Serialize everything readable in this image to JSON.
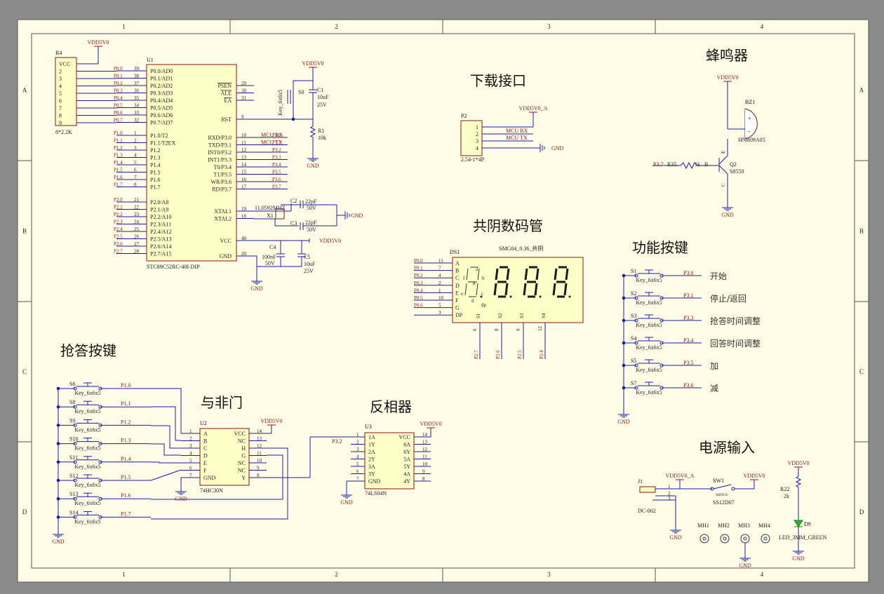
{
  "frame": {
    "columns": [
      "1",
      "2",
      "3",
      "4"
    ],
    "rows": [
      "A",
      "B",
      "C",
      "D"
    ]
  },
  "sections": {
    "download": "下载接口",
    "display": "共阴数码管",
    "buzzer": "蜂鸣器",
    "function_keys": "功能按键",
    "answer_keys": "抢答按键",
    "nand": "与非门",
    "inverter": "反相器",
    "power": "电源输入"
  },
  "r4": {
    "ref": "R4",
    "value": "8*2.2K",
    "pins": [
      "VCC",
      "2",
      "3",
      "4",
      "5",
      "6",
      "7",
      "8",
      "9"
    ],
    "net": "VDD5V0"
  },
  "u1": {
    "ref": "U1",
    "part": "STC89C52RC-40I-DIP",
    "port0": [
      [
        "P0.0/AD0",
        "39",
        "P0.0"
      ],
      [
        "P0.1/AD1",
        "38",
        "P0.1"
      ],
      [
        "P0.2/AD2",
        "37",
        "P0.2"
      ],
      [
        "P0.3/AD3",
        "36",
        "P0.3"
      ],
      [
        "P0.4/AD4",
        "35",
        "P0.4"
      ],
      [
        "P0.5/AD5",
        "34",
        "P0.5"
      ],
      [
        "P0.6/AD6",
        "33",
        "P0.6"
      ],
      [
        "P0.7/AD7",
        "32",
        "P0.7"
      ]
    ],
    "port1": [
      [
        "P1.0/T2",
        "1",
        "P1.0"
      ],
      [
        "P1.1/T2EX",
        "2",
        "P1.1"
      ],
      [
        "P1.2",
        "3",
        "P1.2"
      ],
      [
        "P1.3",
        "4",
        "P1.3"
      ],
      [
        "P1.4",
        "5",
        "P1.4"
      ],
      [
        "P1.5",
        "6",
        "P1.5"
      ],
      [
        "P1.6",
        "7",
        "P1.6"
      ],
      [
        "P1.7",
        "8",
        "P1.7"
      ]
    ],
    "port2": [
      [
        "P2.0/A8",
        "21",
        "P2.0"
      ],
      [
        "P2.1/A9",
        "22",
        "P2.1"
      ],
      [
        "P2.2/A10",
        "23",
        "P2.2"
      ],
      [
        "P2.3/A11",
        "24",
        "P2.3"
      ],
      [
        "P2.4/A12",
        "25",
        "P2.4"
      ],
      [
        "P2.5/A13",
        "26",
        "P2.5"
      ],
      [
        "P2.6/A14",
        "27",
        "P2.6"
      ],
      [
        "P2.7/A15",
        "28",
        "P2.7"
      ]
    ],
    "top_right": [
      [
        "PSEN",
        "29"
      ],
      [
        "ALE",
        "30"
      ],
      [
        "EA",
        "31"
      ],
      [
        "RST",
        "9"
      ]
    ],
    "port3": [
      [
        "RXD/P3.0",
        "10",
        "MCU RX",
        "P3.0"
      ],
      [
        "TXD/P3.1",
        "11",
        "MCU TX",
        "P3.1"
      ],
      [
        "INT0/P3.2",
        "12",
        "",
        "P3.2"
      ],
      [
        "INT1/P3.3",
        "13",
        "",
        "P3.3"
      ],
      [
        "T0/P3.4",
        "14",
        "",
        "P3.4"
      ],
      [
        "T1/P3.5",
        "15",
        "",
        "P3.5"
      ],
      [
        "WR/P3.6",
        "16",
        "",
        "P3.6"
      ],
      [
        "RD/P3.7",
        "17",
        "",
        "P3.7"
      ]
    ],
    "xtal": [
      [
        "XTAL1",
        "19"
      ],
      [
        "XTAL2",
        "18"
      ]
    ],
    "power": [
      [
        "VCC",
        "40"
      ],
      [
        "GND",
        "20"
      ]
    ]
  },
  "reset": {
    "key": "Key_6x6x5",
    "s": "S0",
    "c1": "C1",
    "c1v": "10uF",
    "c1v2": "25V",
    "r1": "R1",
    "r1v": "10k",
    "net": "VDD5V0"
  },
  "crystal": {
    "x1": "X1",
    "freq": "11.0592MHZ",
    "c2": "C2",
    "c3": "C3",
    "cv": "22pF",
    "cv2": "50V"
  },
  "decoupling": {
    "c4": "C4",
    "c4v": "100nF",
    "c4v2": "50V",
    "c5": "C5",
    "c5v": "10uF",
    "c5v2": "25V",
    "net": "VDD5V0"
  },
  "gnd": "GND",
  "vdd": "VDD5V0",
  "p2": {
    "ref": "P2",
    "part": "2.54-1*4P",
    "pins": [
      "1",
      "2",
      "3",
      "4"
    ],
    "nets": [
      "VDD5V0_A",
      "MCU RX",
      "MCU TX",
      "GND"
    ]
  },
  "ds1": {
    "ref": "DS1",
    "part": "SMG04_0.36_共阴",
    "nets": [
      "P0.0",
      "P0.1",
      "P0.2",
      "P0.3",
      "P0.4",
      "P0.5",
      "P0.6",
      ""
    ],
    "pins": [
      "11",
      "7",
      "4",
      "2",
      "1",
      "10",
      "5",
      "3"
    ],
    "letters": [
      "A",
      "B",
      "C",
      "D",
      "E",
      "F",
      "G",
      "DP"
    ],
    "seg_labels": [
      "a",
      "b",
      "c",
      "d",
      "e",
      "f",
      "g",
      "dp"
    ],
    "digits": [
      "S1",
      "S2",
      "S3",
      "S4"
    ],
    "dpins": [
      "6",
      "8",
      "9",
      "12"
    ],
    "dnets": [
      "P2.7",
      "P2.6",
      "P2.5",
      "P2.4"
    ]
  },
  "bz": {
    "ref": "BZ1",
    "part": "HNB09A05",
    "q": "Q2",
    "qpart": "S8550",
    "r": "R35",
    "rv": "1k",
    "net": "P3.7",
    "plus": "+",
    "minus": "-",
    "b": "B",
    "e": "E",
    "c": "C"
  },
  "func_keys": [
    {
      "s": "S1",
      "key": "Key_6x6x5",
      "net": "P3.0",
      "label": "开始"
    },
    {
      "s": "S2",
      "key": "Key_6x6x5",
      "net": "P3.1",
      "label": "停止/返回"
    },
    {
      "s": "S3",
      "key": "Key_6x6x5",
      "net": "P3.3",
      "label": "抢答时间调整"
    },
    {
      "s": "S4",
      "key": "Key_6x6x5",
      "net": "P3.4",
      "label": "回答时间调整"
    },
    {
      "s": "S5",
      "key": "Key_6x6x5",
      "net": "P3.5",
      "label": "加"
    },
    {
      "s": "S7",
      "key": "Key_6x6x5",
      "net": "P3.6",
      "label": "减"
    }
  ],
  "ans_keys": [
    {
      "s": "S6",
      "key": "Key_6x6x5",
      "net": "P1.0"
    },
    {
      "s": "S8",
      "key": "Key_6x6x5",
      "net": "P1.1"
    },
    {
      "s": "S9",
      "key": "Key_6x6x5",
      "net": "P1.2"
    },
    {
      "s": "S10",
      "key": "Key_6x6x5",
      "net": "P1.3"
    },
    {
      "s": "S11",
      "key": "Key_6x6x5",
      "net": "P1.4"
    },
    {
      "s": "S12",
      "key": "Key_6x6x5",
      "net": "P1.5"
    },
    {
      "s": "S13",
      "key": "Key_6x6x5",
      "net": "P1.6"
    },
    {
      "s": "S14",
      "key": "Key_6x6x5",
      "net": "P1.7"
    }
  ],
  "u2": {
    "ref": "U2",
    "part": "74HC30N",
    "left": [
      [
        "A",
        "1"
      ],
      [
        "B",
        "2"
      ],
      [
        "C",
        "3"
      ],
      [
        "D",
        "4"
      ],
      [
        "E",
        "5"
      ],
      [
        "F",
        "6"
      ],
      [
        "GND",
        "7"
      ]
    ],
    "right": [
      [
        "VCC",
        "14"
      ],
      [
        "NC",
        "13"
      ],
      [
        "H",
        "12"
      ],
      [
        "G",
        "11"
      ],
      [
        "NC",
        "10"
      ],
      [
        "NC",
        "9"
      ],
      [
        "Y",
        "8"
      ]
    ]
  },
  "u3": {
    "ref": "U3",
    "part": "74LS04N",
    "net": "P3.2",
    "left": [
      [
        "1A",
        "1"
      ],
      [
        "1Y",
        "2"
      ],
      [
        "2A",
        "3"
      ],
      [
        "2Y",
        "4"
      ],
      [
        "3A",
        "5"
      ],
      [
        "3Y",
        "6"
      ],
      [
        "GND",
        "7"
      ]
    ],
    "right": [
      [
        "VCC",
        "14"
      ],
      [
        "6A",
        "13"
      ],
      [
        "6Y",
        "12"
      ],
      [
        "5A",
        "11"
      ],
      [
        "5Y",
        "10"
      ],
      [
        "4A",
        "9"
      ],
      [
        "4Y",
        "8"
      ]
    ]
  },
  "pwr": {
    "j1": "J1",
    "jpart": "DC-002",
    "jnet": "VDD5V0_A",
    "jpins": [
      "1",
      "2",
      "3"
    ],
    "sw": "SW1",
    "swpart": "SS12D07",
    "swname": "SHDOX",
    "r22": "R22",
    "r22v": "2k",
    "d9": "D9",
    "d9part": "LED_3MM_GREEN",
    "mh": [
      "MH1",
      "MH2",
      "MH3",
      "MH4"
    ]
  }
}
